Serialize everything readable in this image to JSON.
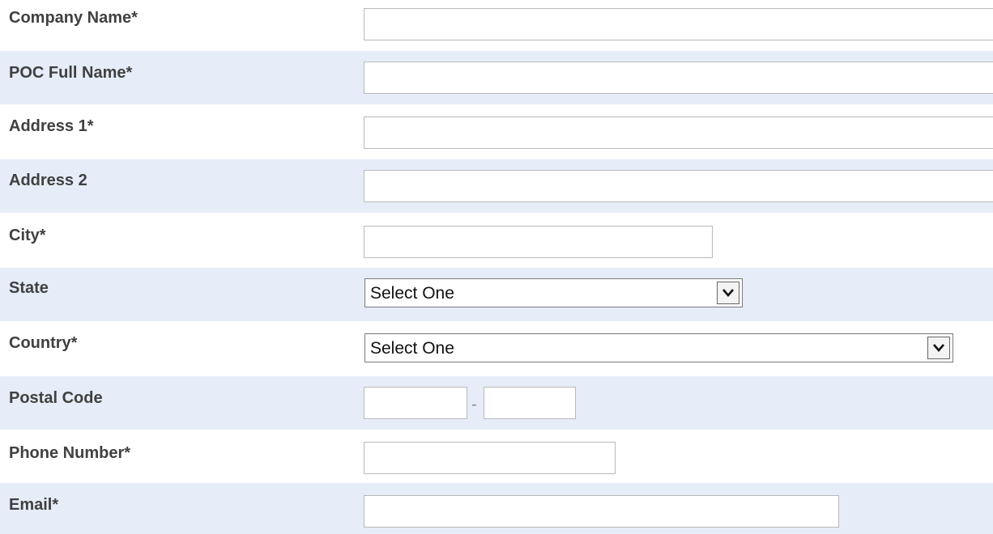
{
  "form": {
    "company_name": {
      "label": "Company Name*",
      "value": ""
    },
    "poc_full_name": {
      "label": "POC Full Name*",
      "value": ""
    },
    "address1": {
      "label": "Address 1*",
      "value": ""
    },
    "address2": {
      "label": "Address 2",
      "value": ""
    },
    "city": {
      "label": "City*",
      "value": ""
    },
    "state": {
      "label": "State",
      "selected": "Select One"
    },
    "country": {
      "label": "Country*",
      "selected": "Select One"
    },
    "postal_code": {
      "label": "Postal Code",
      "value_part1": "",
      "value_part2": "",
      "separator": "-"
    },
    "phone": {
      "label": "Phone Number*",
      "value": ""
    },
    "email": {
      "label": "Email*",
      "value": ""
    }
  },
  "colors": {
    "row_alt_background": "#e6ecf8",
    "label_text": "#404040"
  }
}
